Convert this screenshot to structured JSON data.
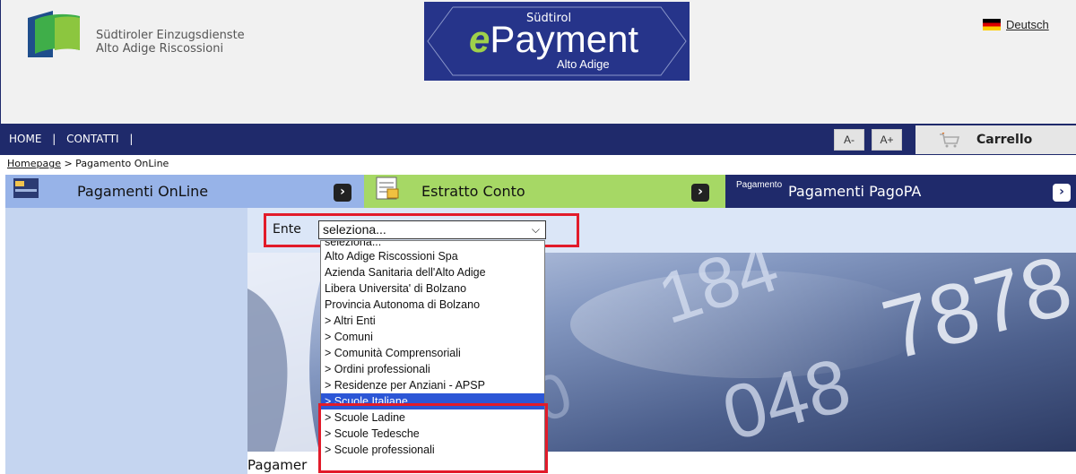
{
  "header": {
    "org_line1": "Südtiroler Einzugsdienste",
    "org_line2": "Alto Adige Riscossioni",
    "epay_top": "Südtirol",
    "epay_e": "e",
    "epay_main": "Payment",
    "epay_bottom": "Alto Adige",
    "language_link": "Deutsch"
  },
  "nav": {
    "home": "HOME",
    "sep1": "|",
    "contatti": "CONTATTI",
    "sep2": "|",
    "font_decrease": "A-",
    "font_increase": "A+",
    "cart": "Carrello"
  },
  "breadcrumb": {
    "home": "Homepage",
    "current": " > Pagamento OnLine"
  },
  "tabs": [
    {
      "label": "Pagamenti OnLine",
      "color": "#97b3e8",
      "arrow": "›"
    },
    {
      "label": "Estratto Conto",
      "color": "#a6d865",
      "arrow": "›"
    },
    {
      "label": "Pagamenti PagoPA",
      "color": "#1f2a6b",
      "arrow": "›",
      "img_alt": "Pagamento"
    }
  ],
  "form": {
    "ente_label": "Ente",
    "select_value": "seleziona...",
    "options": [
      "seleziona...",
      "Alto Adige Riscossioni Spa",
      "Azienda Sanitaria dell'Alto Adige",
      "Libera Universita' di Bolzano",
      "Provincia Autonoma di Bolzano",
      "> Altri Enti",
      "> Comuni",
      "> Comunità Comprensoriali",
      "> Ordini professionali",
      "> Residenze per Anziani - APSP",
      "> Scuole Italiane",
      "> Scuole Ladine",
      "> Scuole Tedesche",
      "> Scuole professionali"
    ],
    "selected_index": 10
  },
  "footer_text": "Pagamer",
  "colors": {
    "navy": "#1f2a6b",
    "highlight_red": "#e21b2a",
    "selected_blue": "#2c56d6"
  }
}
